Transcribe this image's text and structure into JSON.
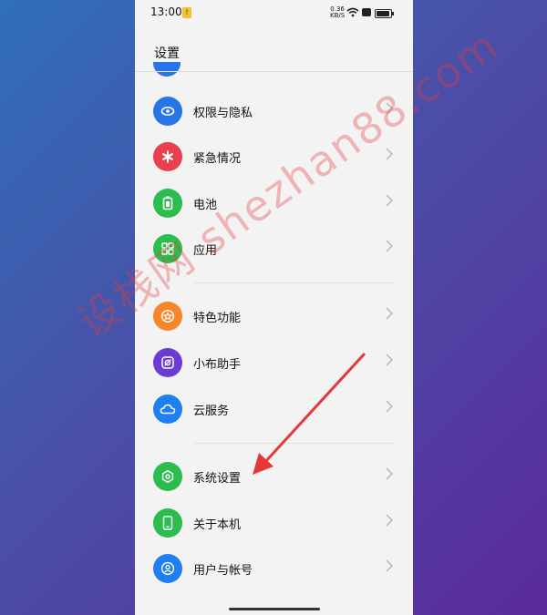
{
  "status_bar": {
    "time": "13:00",
    "net_speed": "0.36\nKB/S"
  },
  "header": {
    "title": "设置"
  },
  "settings_items": [
    {
      "label": "权限与隐私",
      "color": "#2a74e9",
      "icon": "privacy-shield-icon"
    },
    {
      "label": "紧急情况",
      "color": "#e8404f",
      "icon": "asterisk-icon"
    },
    {
      "label": "电池",
      "color": "#2dbd4e",
      "icon": "battery-icon"
    },
    {
      "label": "应用",
      "color": "#2dbd4e",
      "icon": "apps-grid-icon"
    },
    {
      "label": "特色功能",
      "color": "#f5862a",
      "icon": "star-circle-icon"
    },
    {
      "label": "小布助手",
      "color": "#6a3cd4",
      "icon": "assistant-icon"
    },
    {
      "label": "云服务",
      "color": "#1e7ff0",
      "icon": "cloud-icon"
    },
    {
      "label": "系统设置",
      "color": "#2dbd4e",
      "icon": "hexagon-gear-icon"
    },
    {
      "label": "关于本机",
      "color": "#2dbd4e",
      "icon": "phone-icon"
    },
    {
      "label": "用户与帐号",
      "color": "#1e7ff0",
      "icon": "user-icon"
    }
  ],
  "watermark": "设栈网 shezhan88.com"
}
